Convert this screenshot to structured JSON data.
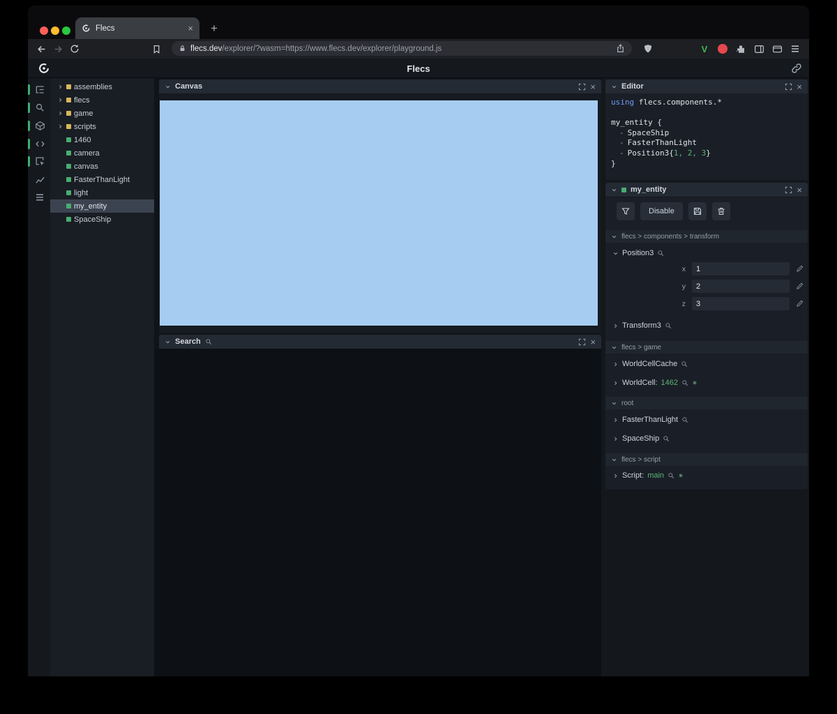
{
  "icons": {
    "close": "×",
    "plus": "+"
  },
  "browser": {
    "tab": {
      "title": "Flecs"
    },
    "url": {
      "domain": "flecs.dev",
      "rest": "/explorer/?wasm=https://www.flecs.dev/explorer/playground.js"
    },
    "extensions": {
      "v_label": "V"
    }
  },
  "app": {
    "title": "Flecs"
  },
  "tree": {
    "items": [
      {
        "label": "assemblies",
        "kind": "module"
      },
      {
        "label": "flecs",
        "kind": "module"
      },
      {
        "label": "game",
        "kind": "module"
      },
      {
        "label": "scripts",
        "kind": "module"
      },
      {
        "label": "1460",
        "kind": "entity"
      },
      {
        "label": "camera",
        "kind": "entity"
      },
      {
        "label": "canvas",
        "kind": "entity"
      },
      {
        "label": "FasterThanLight",
        "kind": "entity"
      },
      {
        "label": "light",
        "kind": "entity"
      },
      {
        "label": "my_entity",
        "kind": "entity",
        "selected": true
      },
      {
        "label": "SpaceShip",
        "kind": "entity"
      }
    ]
  },
  "panels": {
    "canvas": {
      "title": "Canvas"
    },
    "search": {
      "title": "Search"
    },
    "editor": {
      "title": "Editor"
    },
    "inspector": {
      "title": "my_entity"
    }
  },
  "editor_code": {
    "kw_using": "using",
    "using_rest": " flecs.components.*",
    "l_entity_open": "my_entity {",
    "dash": "-",
    "c_spaceship": "SpaceShip",
    "c_ftl": "FasterThanLight",
    "c_pos_name": "Position3",
    "c_pos_open": "{",
    "c_pos_nums": "1, 2, 3",
    "c_pos_close": "}",
    "l_close": "}"
  },
  "inspector": {
    "disable_label": "Disable",
    "sections": {
      "transform": "flecs > components > transform",
      "game": "flecs > game",
      "root": "root",
      "script": "flecs > script"
    },
    "position3": {
      "name": "Position3",
      "fields": [
        {
          "label": "x",
          "value": "1"
        },
        {
          "label": "y",
          "value": "2"
        },
        {
          "label": "z",
          "value": "3"
        }
      ]
    },
    "transform3": "Transform3",
    "world_cell_cache": "WorldCellCache",
    "world_cell": {
      "name": "WorldCell:",
      "value": "1462"
    },
    "faster_than_light": "FasterThanLight",
    "space_ship": "SpaceShip",
    "script": {
      "name": "Script:",
      "value": "main"
    }
  },
  "colors": {
    "accent_green": "#3fae6f",
    "module_yellow": "#d8b65c",
    "entity_green": "#48ad71",
    "canvas_blue": "#a6cdf1",
    "keyword_blue": "#6f9bf3",
    "value_green": "#5cb377"
  }
}
